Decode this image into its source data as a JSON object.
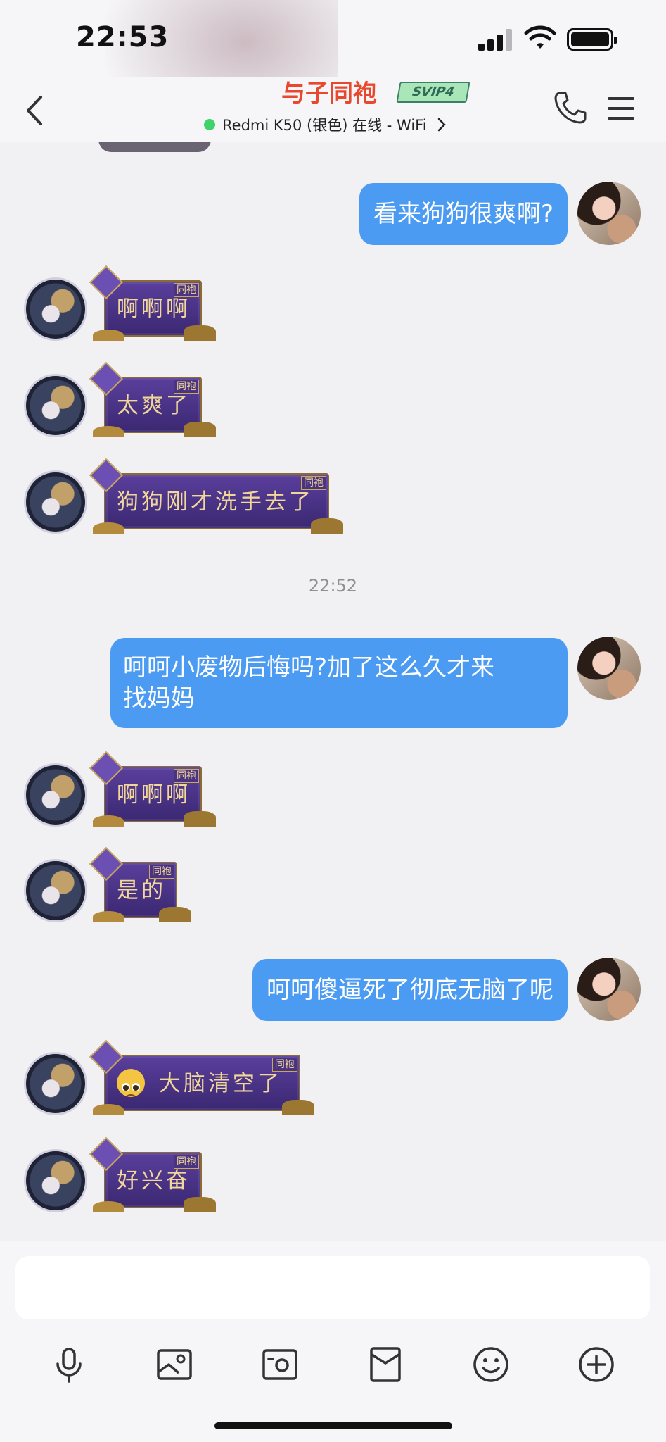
{
  "status_bar": {
    "time": "22:53"
  },
  "header": {
    "title": "与子同袍",
    "vip_badge": "SVIP4",
    "online_status": "Redmi K50 (银色) 在线 - WiFi"
  },
  "chat": {
    "messages": [
      {
        "from": "me",
        "text": "看来狗狗很爽啊?"
      },
      {
        "from": "other",
        "text": "啊啊啊",
        "tag": "同袍"
      },
      {
        "from": "other",
        "text": "太爽了",
        "tag": "同袍"
      },
      {
        "from": "other",
        "text": "狗狗刚才洗手去了",
        "tag": "同袍"
      },
      {
        "type": "timestamp",
        "text": "22:52"
      },
      {
        "from": "me",
        "text_line1": "呵呵小废物后悔吗?加了这么久才来",
        "text_line2": "找妈妈"
      },
      {
        "from": "other",
        "text": "啊啊啊",
        "tag": "同袍"
      },
      {
        "from": "other",
        "text": "是的",
        "tag": "同袍"
      },
      {
        "from": "me",
        "text": "呵呵傻逼死了彻底无脑了呢"
      },
      {
        "from": "other",
        "text": "大脑清空了",
        "tag": "同袍",
        "emoji": "pleading-face"
      },
      {
        "from": "other",
        "text": "好兴奋",
        "tag": "同袍"
      }
    ]
  },
  "input": {
    "value": "",
    "placeholder": ""
  },
  "toolbar": [
    "microphone-icon",
    "image-icon",
    "camera-icon",
    "red-packet-icon",
    "emoji-icon",
    "plus-icon"
  ],
  "colors": {
    "accent_blue": "#4c9bf3",
    "title_red": "#e8492e",
    "online_green": "#3ed36b",
    "bubble_purple": "#4a3386",
    "bubble_gold_text": "#f1d79a"
  }
}
